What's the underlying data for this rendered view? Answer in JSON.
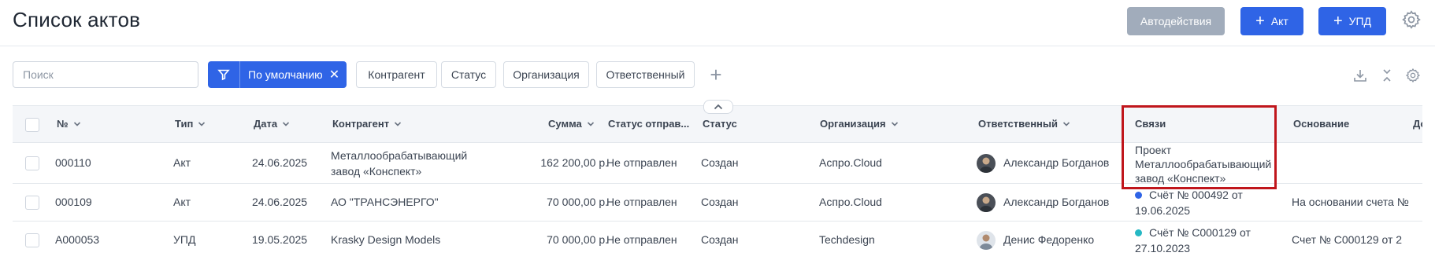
{
  "header": {
    "title": "Список актов",
    "buttons": {
      "auto": "Автодействия",
      "akt": "Акт",
      "upd": "УПД"
    }
  },
  "filters": {
    "search_placeholder": "Поиск",
    "preset_label": "По умолчанию",
    "chips": [
      "Контрагент",
      "Статус",
      "Организация",
      "Ответственный"
    ]
  },
  "table": {
    "columns": {
      "number": "№",
      "type": "Тип",
      "date": "Дата",
      "counterparty": "Контрагент",
      "sum": "Сумма",
      "send_status": "Статус отправ...",
      "status": "Статус",
      "organization": "Организация",
      "responsible": "Ответственный",
      "links": "Связи",
      "basis": "Основание",
      "extra": "До"
    },
    "rows": [
      {
        "number": "000110",
        "type": "Акт",
        "date": "24.06.2025",
        "counterparty_l1": "Металлообрабатывающий",
        "counterparty_l2": "завод «Конспект»",
        "sum": "162 200,00 р.",
        "send_status": "Не отправлен",
        "status": "Создан",
        "organization": "Аспро.Cloud",
        "responsible": "Александр Богданов",
        "links_l1": "Проект",
        "links_l2": "Металлообрабатывающий",
        "links_l3": "завод «Конспект»",
        "basis": ""
      },
      {
        "number": "000109",
        "type": "Акт",
        "date": "24.06.2025",
        "counterparty": "АО \"ТРАНСЭНЕРГО\"",
        "sum": "70 000,00 р.",
        "send_status": "Не отправлен",
        "status": "Создан",
        "organization": "Аспро.Cloud",
        "responsible": "Александр Богданов",
        "links_l1": "Счёт № 000492 от",
        "links_l2": "19.06.2025",
        "links_dot": "#2f64e6",
        "basis": "На основании счета №"
      },
      {
        "number": "А000053",
        "type": "УПД",
        "date": "19.05.2025",
        "counterparty": "Krasky Design Models",
        "sum": "70 000,00 р.",
        "send_status": "Не отправлен",
        "status": "Создан",
        "organization": "Techdesign",
        "responsible": "Денис Федоренко",
        "links_l1": "Счёт № С000129 от",
        "links_l2": "27.10.2023",
        "links_dot": "#26b8c4",
        "basis": "Счет № С000129 от 2"
      }
    ]
  },
  "colors": {
    "primary": "#2f64e6",
    "muted_button": "#a1acbb",
    "highlight": "#c0161c"
  }
}
